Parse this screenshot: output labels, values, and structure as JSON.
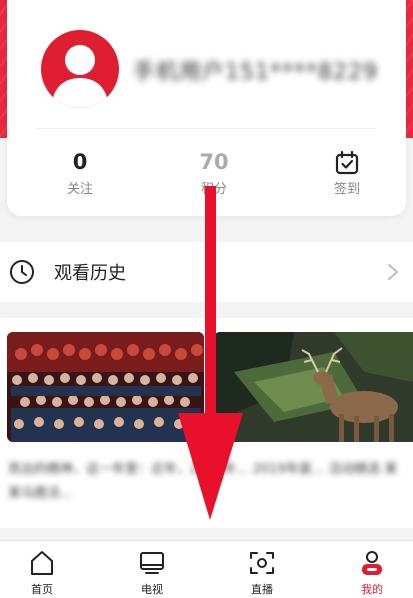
{
  "profile": {
    "username": "手机用户151****8229"
  },
  "stats": {
    "follow": {
      "value": "0",
      "label": "关注"
    },
    "points": {
      "value": "70",
      "label": "积分"
    },
    "checkin": {
      "label": "签到",
      "icon": "calendar-check-icon"
    }
  },
  "history": {
    "title": "观看历史",
    "icon": "clock-icon"
  },
  "videos": {
    "caption": "亮出的精神，这一年里：近年，2019年... 2019年度... 活动精选 某某马鹿活..."
  },
  "nav": {
    "items": [
      {
        "label": "首页",
        "icon": "home-icon"
      },
      {
        "label": "电视",
        "icon": "tv-icon"
      },
      {
        "label": "直播",
        "icon": "live-icon"
      },
      {
        "label": "我的",
        "icon": "profile-icon"
      }
    ],
    "active_color": "#e01e31"
  },
  "colors": {
    "brand": "#e01e31",
    "header": "#e8283c",
    "annotation_arrow": "#e8102a"
  }
}
